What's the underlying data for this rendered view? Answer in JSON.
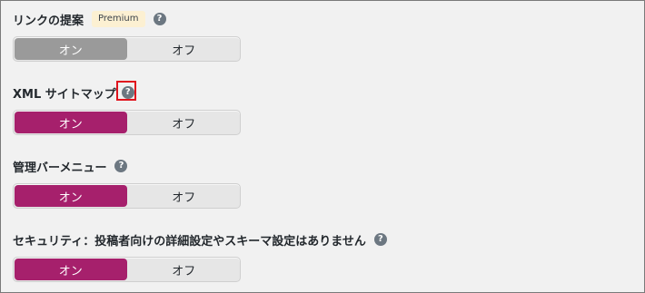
{
  "settings": [
    {
      "title": "リンクの提案",
      "badge": "Premium",
      "help": "?",
      "on_label": "オン",
      "off_label": "オフ",
      "state": "on",
      "style": "disabled-premium"
    },
    {
      "title": "XML サイトマップ",
      "help": "?",
      "on_label": "オン",
      "off_label": "オフ",
      "state": "on",
      "highlighted_help": true
    },
    {
      "title": "管理バーメニュー",
      "help": "?",
      "on_label": "オン",
      "off_label": "オフ",
      "state": "on"
    },
    {
      "title": "セキュリティ：投稿者向けの詳細設定やスキーマ設定はありません",
      "help": "?",
      "on_label": "オン",
      "off_label": "オフ",
      "state": "on"
    }
  ],
  "colors": {
    "active": "#a6206c",
    "active_disabled": "#9a9a9a",
    "badge_bg": "#fcf0d2",
    "highlight_box": "#e0141e"
  }
}
